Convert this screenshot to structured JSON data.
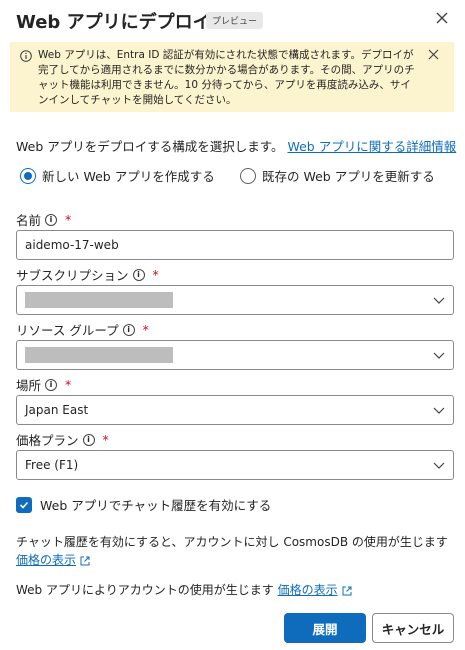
{
  "header": {
    "title": "Web アプリにデプロイ",
    "badge": "プレビュー"
  },
  "warning": {
    "text": "Web アプリは、Entra ID 認証が有効にされた状態で構成されます。デプロイが完了してから適用されるまでに数分かかる場合があります。その間、アプリのチャット機能は利用できません。10 分待ってから、アプリを再度読み込み、サインインしてチャットを開始してください。"
  },
  "intro": {
    "text": "Web アプリをデプロイする構成を選択します。",
    "link": "Web アプリに関する詳細情報"
  },
  "options": {
    "create_new": "新しい Web アプリを作成する",
    "update_existing": "既存の Web アプリを更新する"
  },
  "fields": {
    "name": {
      "label": "名前",
      "value": "aidemo-17-web"
    },
    "subscription": {
      "label": "サブスクリプション"
    },
    "resource_group": {
      "label": "リソース グループ"
    },
    "location": {
      "label": "場所",
      "value": "Japan East"
    },
    "pricing_plan": {
      "label": "価格プラン",
      "value": "Free (F1)"
    }
  },
  "checkbox": {
    "label": "Web アプリでチャット履歴を有効にする"
  },
  "notes": {
    "chat_history": "チャット履歴を有効にすると、アカウントに対し CosmosDB の使用が生じます",
    "chat_history_link": "価格の表示",
    "usage": "Web アプリによりアカウントの使用が生じます",
    "usage_link": "価格の表示"
  },
  "buttons": {
    "deploy": "展開",
    "cancel": "キャンセル"
  },
  "colors": {
    "accent": "#0f6cbd",
    "warning_bg": "#fcf4ce",
    "required": "#c50f1f"
  }
}
